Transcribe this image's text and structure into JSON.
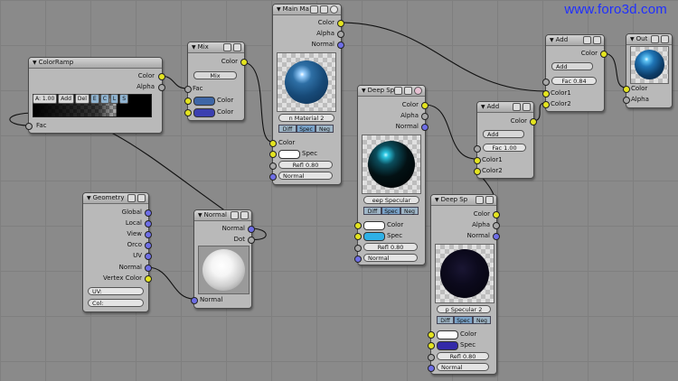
{
  "watermark": "www.foro3d.com",
  "nodes": {
    "colorramp": {
      "title": "ColorRamp",
      "outputs": [
        "Color",
        "Alpha"
      ],
      "bar": [
        "A: 1.00",
        "Add",
        "Del",
        "E",
        "C",
        "L",
        "S"
      ],
      "input": "Fac"
    },
    "mix": {
      "title": "Mix",
      "output": "Color",
      "mode": "Mix",
      "inputs": [
        "Fac",
        "Color",
        "Color"
      ],
      "swatch1": "#3e66a6",
      "swatch2": "#3b3fb0"
    },
    "mainmat": {
      "title": "Main Ma",
      "outputs": [
        "Color",
        "Alpha",
        "Normal"
      ],
      "material": "n Material",
      "users": "2",
      "toggles": [
        "Diff",
        "Spec",
        "Neg"
      ],
      "inputs": [
        "Color",
        "Spec",
        "Refl 0.80",
        "Normal"
      ]
    },
    "deep1": {
      "title": "Deep Sp",
      "outputs": [
        "Color",
        "Alpha",
        "Normal"
      ],
      "material": "eep Specular",
      "toggles": [
        "Diff",
        "Spec",
        "Neg"
      ],
      "inputs": [
        "Color",
        "Spec",
        "Refl 0.80",
        "Normal"
      ]
    },
    "deep2": {
      "title": "Deep Sp",
      "outputs": [
        "Color",
        "Alpha",
        "Normal"
      ],
      "material": "p Specular 2",
      "toggles": [
        "Diff",
        "Spec",
        "Neg"
      ],
      "inputs": [
        "Color",
        "Spec",
        "Refl 0.80",
        "Normal"
      ]
    },
    "geometry": {
      "title": "Geometry",
      "outputs": [
        "Global",
        "Local",
        "View",
        "Orco",
        "UV",
        "Normal",
        "Vertex Color"
      ],
      "fields": [
        "UV:",
        "Col:"
      ]
    },
    "normal": {
      "title": "Normal",
      "outputs": [
        "Normal",
        "Dot"
      ],
      "input": "Normal"
    },
    "add1": {
      "title": "Add",
      "output": "Color",
      "mode": "Add",
      "fac": "Fac 0.84",
      "inputs": [
        "Color1",
        "Color2"
      ]
    },
    "add2": {
      "title": "Add",
      "output": "Color",
      "mode": "Add",
      "fac": "Fac 1.00",
      "inputs": [
        "Color1",
        "Color2"
      ]
    },
    "out": {
      "title": "Out",
      "inputs": [
        "Color",
        "Alpha"
      ]
    }
  },
  "colors": {
    "background": "#8a8a8a",
    "node": "#b9b9b9",
    "socket_color": "#e4e420",
    "socket_value": "#a8a8a8",
    "socket_vector": "#6e6ee6",
    "watermark": "#1f2fff"
  }
}
